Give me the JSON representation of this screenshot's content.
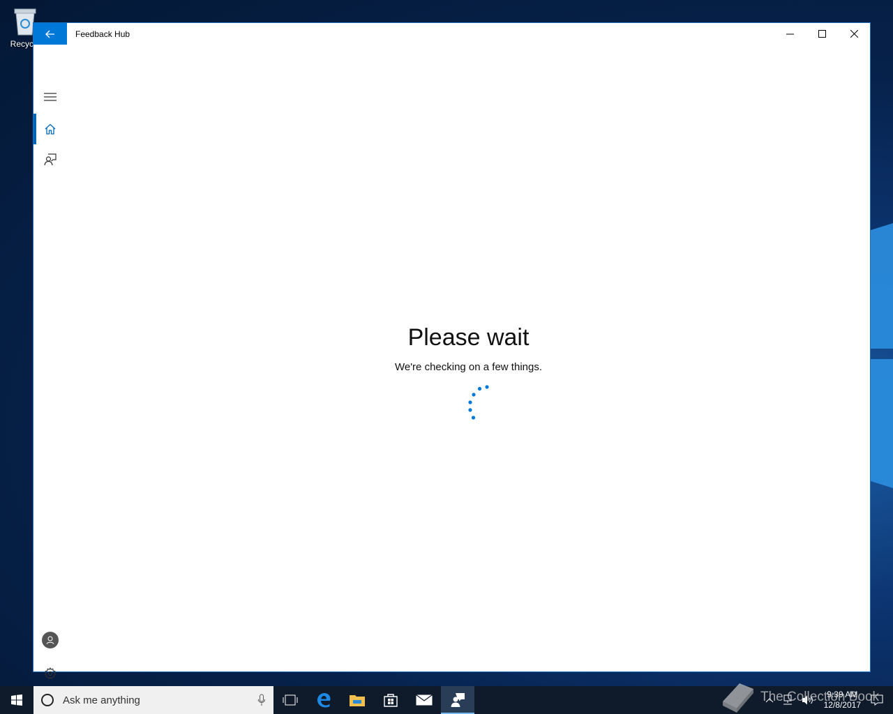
{
  "desktop": {
    "recycle_label": "Recycle"
  },
  "window": {
    "title": "Feedback Hub",
    "accent": "#0078d7"
  },
  "nav": {
    "items": [
      {
        "icon": "hamburger-icon"
      },
      {
        "icon": "home-icon",
        "selected": true
      },
      {
        "icon": "feedback-icon"
      }
    ],
    "bottom": [
      {
        "icon": "account-icon"
      },
      {
        "icon": "settings-icon"
      }
    ]
  },
  "main": {
    "title": "Please wait",
    "subtitle": "We're checking on a few things."
  },
  "taskbar": {
    "search_placeholder": "Ask me anything",
    "apps": [
      "task-view-icon",
      "edge-icon",
      "file-explorer-icon",
      "store-icon",
      "mail-icon",
      "feedback-hub-icon"
    ],
    "time": "9:39 AM",
    "date": "12/8/2017"
  },
  "watermark": {
    "text": "The Collection Book"
  }
}
